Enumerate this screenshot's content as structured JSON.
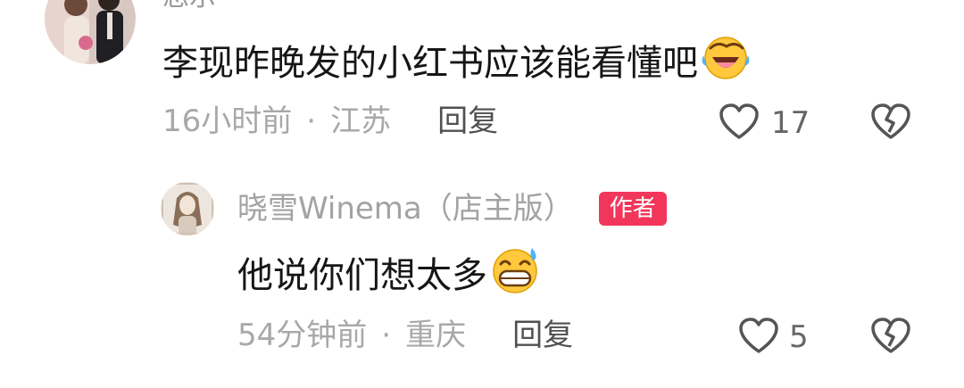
{
  "comment1": {
    "username_partial": "忍示",
    "text": "李现昨晚发的小红书应该能看懂吧",
    "emoji_icon": "face-with-tears-of-joy",
    "time": "16小时前",
    "separator": "·",
    "location": "江苏",
    "reply_label": "回复",
    "likes": "17"
  },
  "reply1": {
    "username": "晓雪Winema（店主版）",
    "badge": "作者",
    "text": "他说你们想太多",
    "emoji_icon": "grinning-face-with-sweat",
    "time": "54分钟前",
    "separator": "·",
    "location": "重庆",
    "reply_label": "回复",
    "likes": "5"
  },
  "colors": {
    "badge_bg": "#f2365b",
    "meta_text": "#a8a8a8",
    "icon_gray": "#555555"
  }
}
